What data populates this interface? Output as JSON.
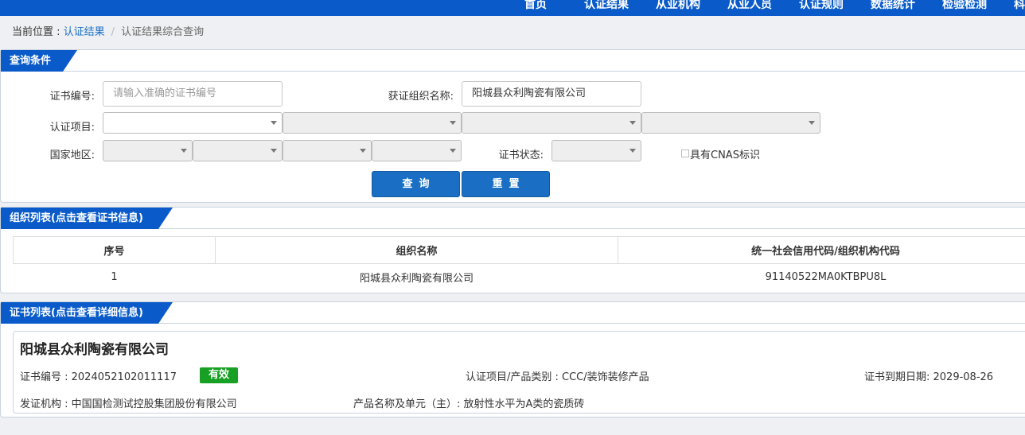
{
  "nav": {
    "items": [
      "首页",
      "认证结果",
      "从业机构",
      "从业人员",
      "认证规则",
      "数据统计",
      "检验检测",
      "科"
    ]
  },
  "breadcrumb": {
    "prefix": "当前位置 : ",
    "link": "认证结果",
    "current": "认证结果综合查询"
  },
  "query": {
    "title": "查询条件",
    "cert_no_label": "证书编号:",
    "cert_no_placeholder": "请输入准确的证书编号",
    "org_name_label": "获证组织名称:",
    "org_name_value": "阳城县众利陶瓷有限公司",
    "project_label": "认证项目:",
    "region_label": "国家地区:",
    "status_label": "证书状态:",
    "cnas_label": "具有CNAS标识",
    "search_button": "查询",
    "reset_button": "重置"
  },
  "org_list": {
    "title": "组织列表(点击查看证书信息)",
    "columns": [
      "序号",
      "组织名称",
      "统一社会信用代码/组织机构代码"
    ],
    "rows": [
      [
        "1",
        "阳城县众利陶瓷有限公司",
        "91140522MA0KTBPU8L"
      ]
    ]
  },
  "cert_list": {
    "title": "证书列表(点击查看详细信息)",
    "cert": {
      "org_name": "阳城县众利陶瓷有限公司",
      "cert_no": "证书编号 : 2024052102011117",
      "status": "有效",
      "status_color": "#17a023",
      "project": "认证项目/产品类别 : CCC/装饰装修产品",
      "expiry": "证书到期日期: 2029-08-26",
      "issuer": "发证机构 : 中国国检测试控股集团股份有限公司",
      "product": "产品名称及单元（主）: 放射性水平为A类的瓷质砖"
    }
  },
  "colors": {
    "brand_blue": "#0a5bc9",
    "button_blue": "#1a6fc4"
  }
}
